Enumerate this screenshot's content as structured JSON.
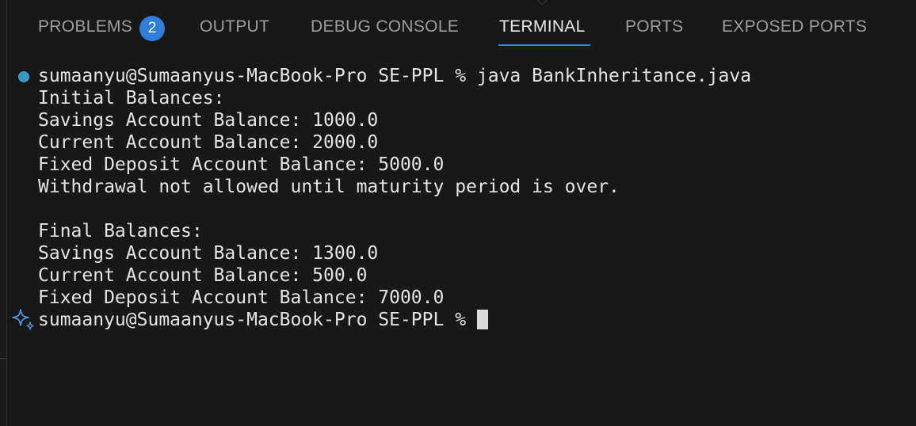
{
  "tabs": [
    {
      "label": "PROBLEMS",
      "badge": "2",
      "active": false
    },
    {
      "label": "OUTPUT",
      "active": false
    },
    {
      "label": "DEBUG CONSOLE",
      "active": false
    },
    {
      "label": "TERMINAL",
      "active": true
    },
    {
      "label": "PORTS",
      "active": false
    },
    {
      "label": "EXPOSED PORTS",
      "active": false
    }
  ],
  "terminal": {
    "command_line": "sumaanyu@Sumaanyus-MacBook-Pro SE-PPL % java BankInheritance.java",
    "output": [
      "Initial Balances:",
      "Savings Account Balance: 1000.0",
      "Current Account Balance: 2000.0",
      "Fixed Deposit Account Balance: 5000.0",
      "Withdrawal not allowed until maturity period is over.",
      "",
      "Final Balances:",
      "Savings Account Balance: 1300.0",
      "Current Account Balance: 500.0",
      "Fixed Deposit Account Balance: 7000.0"
    ],
    "prompt": "sumaanyu@Sumaanyus-MacBook-Pro SE-PPL % "
  },
  "colors": {
    "background": "#181818",
    "accent": "#2f86d7",
    "badge": "#2f7ed8",
    "decoration_dot": "#3a98c6",
    "text": "#e4e4e4",
    "inactive_tab": "#9d9d9d"
  },
  "icons": {
    "command_decoration": "circle-icon",
    "prompt_decoration": "sparkle-icon"
  }
}
